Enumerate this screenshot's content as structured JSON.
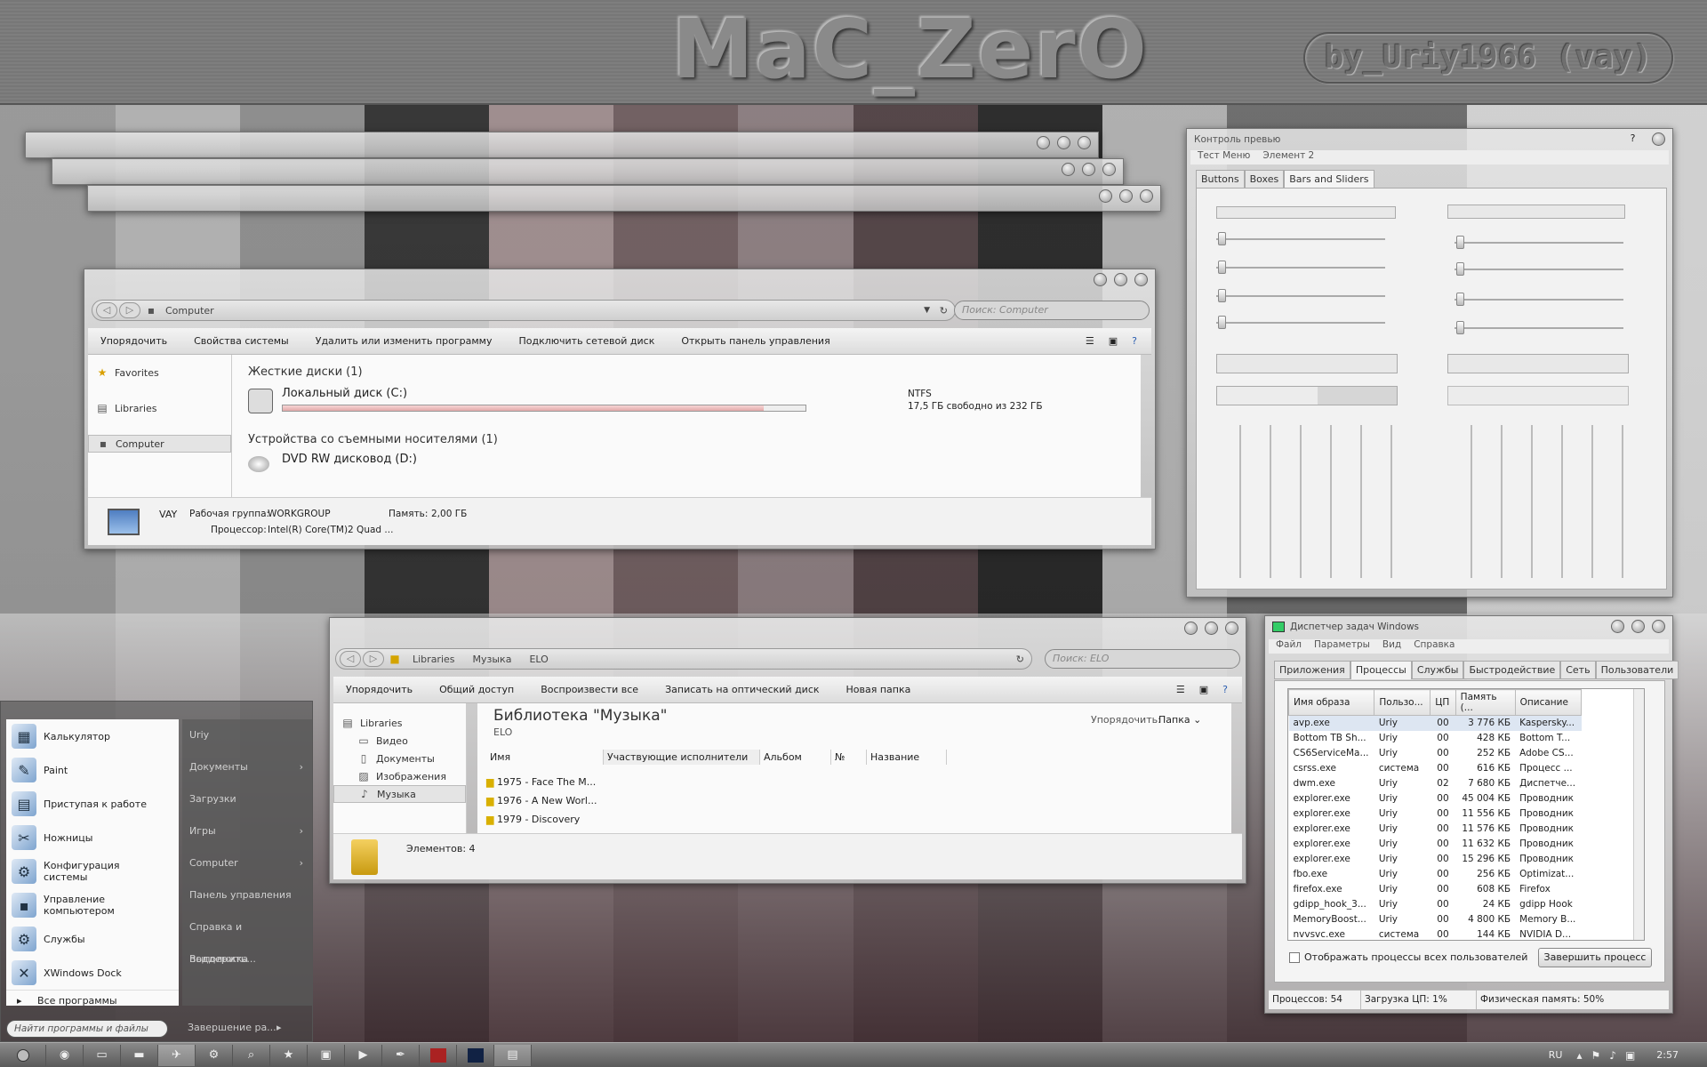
{
  "header": {
    "title": "MaC_ZerO",
    "signature": "by_Uriy1966  (vay)"
  },
  "computer": {
    "address": "Computer",
    "search_placeholder": "Поиск: Computer",
    "toolbar": [
      "Упорядочить",
      "Свойства системы",
      "Удалить или изменить программу",
      "Подключить сетевой диск",
      "Открыть панель управления"
    ],
    "sidebar": [
      "Favorites",
      "Libraries",
      "Computer"
    ],
    "hdd_group": "Жесткие диски (1)",
    "drive_c": "Локальный диск (C:)",
    "fs": "NTFS",
    "free": "17,5 ГБ свободно из 232 ГБ",
    "drive_c_used": 0.92,
    "removable_group": "Устройства со съемными носителями (1)",
    "drive_d": "DVD RW дисковод (D:)",
    "pc_name": "VAY",
    "wg_label": "Рабочая группа:",
    "wg": "WORKGROUP",
    "mem_label": "Память:",
    "mem": "2,00 ГБ",
    "cpu_label": "Процессор:",
    "cpu": "Intel(R) Core(TM)2 Quad ..."
  },
  "music": {
    "crumbs": [
      "Libraries",
      "Музыка",
      "ELO"
    ],
    "search_placeholder": "Поиск: ELO",
    "toolbar": [
      "Упорядочить",
      "Общий доступ",
      "Воспроизвести все",
      "Записать на оптический диск",
      "Новая папка"
    ],
    "sidebar": [
      "Libraries",
      "Видео",
      "Документы",
      "Изображения",
      "Музыка"
    ],
    "title": "Библиотека \"Музыка\"",
    "subtitle": "ELO",
    "arrange_label": "Упорядочить:",
    "arrange_value": "Папка",
    "columns": [
      "Имя",
      "Участвующие исполнители",
      "Альбом",
      "№",
      "Название"
    ],
    "items": [
      "1975 - Face The M...",
      "1976 - A New Worl...",
      "1979 - Discovery"
    ],
    "count": "Элементов: 4"
  },
  "preview": {
    "title": "Контроль превью",
    "menu": [
      "Тест Меню",
      "Элемент 2"
    ],
    "tabs": [
      "Buttons",
      "Boxes",
      "Bars and Sliders"
    ],
    "help": "?"
  },
  "taskmgr": {
    "title": "Диспетчер задач Windows",
    "menu": [
      "Файл",
      "Параметры",
      "Вид",
      "Справка"
    ],
    "tabs": [
      "Приложения",
      "Процессы",
      "Службы",
      "Быстродействие",
      "Сеть",
      "Пользователи"
    ],
    "columns": [
      "Имя образа",
      "Пользо...",
      "ЦП",
      "Память (...",
      "Описание"
    ],
    "rows": [
      [
        "avp.exe",
        "Uriy",
        "00",
        "3 776 КБ",
        "Kaspersky..."
      ],
      [
        "Bottom TB Sh...",
        "Uriy",
        "00",
        "428 КБ",
        "Bottom T..."
      ],
      [
        "CS6ServiceMa...",
        "Uriy",
        "00",
        "252 КБ",
        "Adobe CS..."
      ],
      [
        "csrss.exe",
        "система",
        "00",
        "616 КБ",
        "Процесс ..."
      ],
      [
        "dwm.exe",
        "Uriy",
        "02",
        "7 680 КБ",
        "Диспетче..."
      ],
      [
        "explorer.exe",
        "Uriy",
        "00",
        "45 004 КБ",
        "Проводник"
      ],
      [
        "explorer.exe",
        "Uriy",
        "00",
        "11 556 КБ",
        "Проводник"
      ],
      [
        "explorer.exe",
        "Uriy",
        "00",
        "11 576 КБ",
        "Проводник"
      ],
      [
        "explorer.exe",
        "Uriy",
        "00",
        "11 632 КБ",
        "Проводник"
      ],
      [
        "explorer.exe",
        "Uriy",
        "00",
        "15 296 КБ",
        "Проводник"
      ],
      [
        "fbo.exe",
        "Uriy",
        "00",
        "256 КБ",
        "Optimizat..."
      ],
      [
        "firefox.exe",
        "Uriy",
        "00",
        "608 КБ",
        "Firefox"
      ],
      [
        "gdipp_hook_3...",
        "Uriy",
        "00",
        "24 КБ",
        "gdipp Hook"
      ],
      [
        "MemoryBoost...",
        "Uriy",
        "00",
        "4 800 КБ",
        "Memory B..."
      ],
      [
        "nvvsvc.exe",
        "система",
        "00",
        "144 КБ",
        "NVIDIA D..."
      ]
    ],
    "show_all": "Отображать процессы всех пользователей",
    "end_process": "Завершить процесс",
    "status_procs": "Процессов: 54",
    "status_cpu": "Загрузка ЦП: 1%",
    "status_mem": "Физическая память: 50%"
  },
  "start": {
    "left": [
      "Калькулятор",
      "Paint",
      "Приступая к работе",
      "Ножницы",
      "Конфигурация системы",
      "Управление компьютером",
      "Службы",
      "XWindows Dock"
    ],
    "all_programs": "Все программы",
    "search_placeholder": "Найти программы и файлы",
    "right": [
      "Uriy",
      "Документы",
      "Загрузки",
      "Игры",
      "Computer",
      "Панель управления",
      "Справка и поддержка",
      "Выполнить..."
    ],
    "shutdown": "Завершение ра..."
  },
  "taskbar": {
    "lang": "RU",
    "time": "2:57"
  }
}
